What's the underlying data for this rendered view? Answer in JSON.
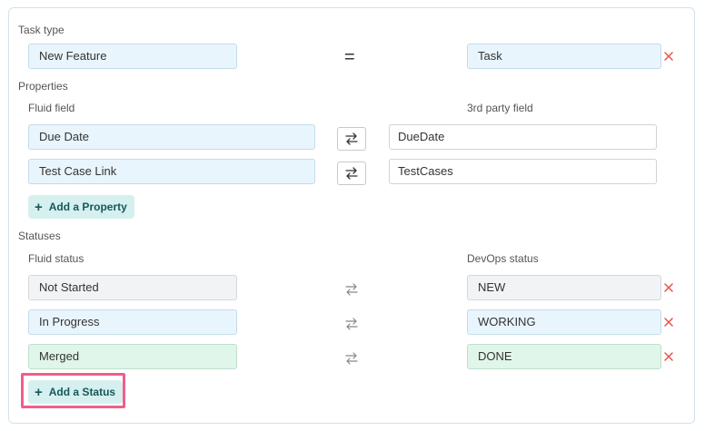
{
  "task_type": {
    "label": "Task type",
    "fluid_value": "New Feature",
    "operator": "=",
    "third_party_value": "Task"
  },
  "properties": {
    "label": "Properties",
    "fluid_col": "Fluid field",
    "third_party_col": "3rd party field",
    "rows": [
      {
        "fluid": "Due Date",
        "third_party": "DueDate"
      },
      {
        "fluid": "Test Case Link",
        "third_party": "TestCases"
      }
    ],
    "add_label": "Add a Property"
  },
  "statuses": {
    "label": "Statuses",
    "fluid_col": "Fluid status",
    "devops_col": "DevOps status",
    "rows": [
      {
        "fluid": "Not Started",
        "devops": "NEW"
      },
      {
        "fluid": "In Progress",
        "devops": "WORKING"
      },
      {
        "fluid": "Merged",
        "devops": "DONE"
      }
    ],
    "add_label": "Add a Status"
  },
  "colors": {
    "remove_icon": "#e5534b",
    "add_button_bg": "#d5f0ef",
    "highlight_border": "#ee5f8c"
  }
}
